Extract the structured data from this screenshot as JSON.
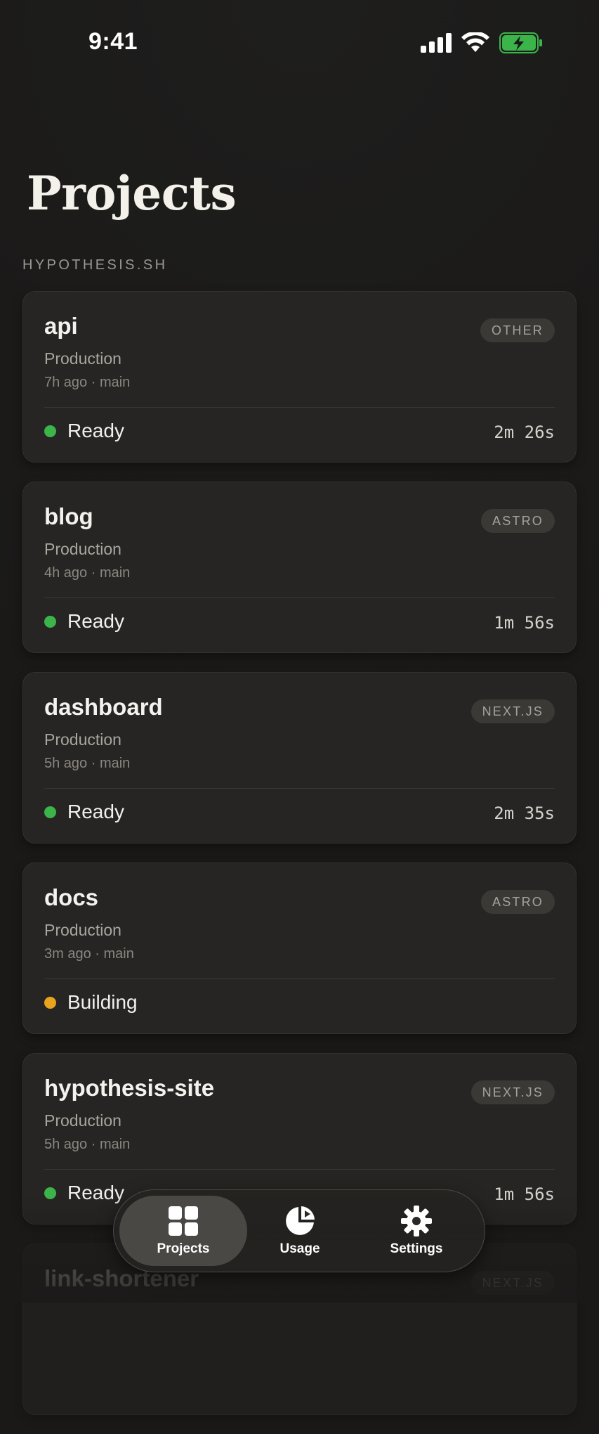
{
  "status_bar": {
    "time": "9:41",
    "icons": [
      "cellular-signal-icon",
      "wifi-icon",
      "battery-charging-icon"
    ]
  },
  "page": {
    "title": "Projects",
    "section": "HYPOTHESIS.SH"
  },
  "colors": {
    "ready": "#3bb54a",
    "building": "#e8a31f",
    "card_bg": "#272523"
  },
  "projects": [
    {
      "name": "api",
      "environment": "Production",
      "meta": "7h ago · main",
      "framework": "OTHER",
      "status": "Ready",
      "duration": "2m 26s"
    },
    {
      "name": "blog",
      "environment": "Production",
      "meta": "4h ago · main",
      "framework": "ASTRO",
      "status": "Ready",
      "duration": "1m 56s"
    },
    {
      "name": "dashboard",
      "environment": "Production",
      "meta": "5h ago · main",
      "framework": "NEXT.JS",
      "status": "Ready",
      "duration": "2m 35s"
    },
    {
      "name": "docs",
      "environment": "Production",
      "meta": "3m ago · main",
      "framework": "ASTRO",
      "status": "Building",
      "duration": ""
    },
    {
      "name": "hypothesis-site",
      "environment": "Production",
      "meta": "5h ago · main",
      "framework": "NEXT.JS",
      "status": "Ready",
      "duration": "1m 56s"
    },
    {
      "name": "link-shortener",
      "environment": "",
      "meta": "",
      "framework": "NEXT.JS",
      "status": "",
      "duration": ""
    }
  ],
  "tab_bar": {
    "tabs": [
      {
        "label": "Projects",
        "icon": "grid-icon",
        "active": true
      },
      {
        "label": "Usage",
        "icon": "pie-chart-icon",
        "active": false
      },
      {
        "label": "Settings",
        "icon": "gear-icon",
        "active": false
      }
    ]
  }
}
